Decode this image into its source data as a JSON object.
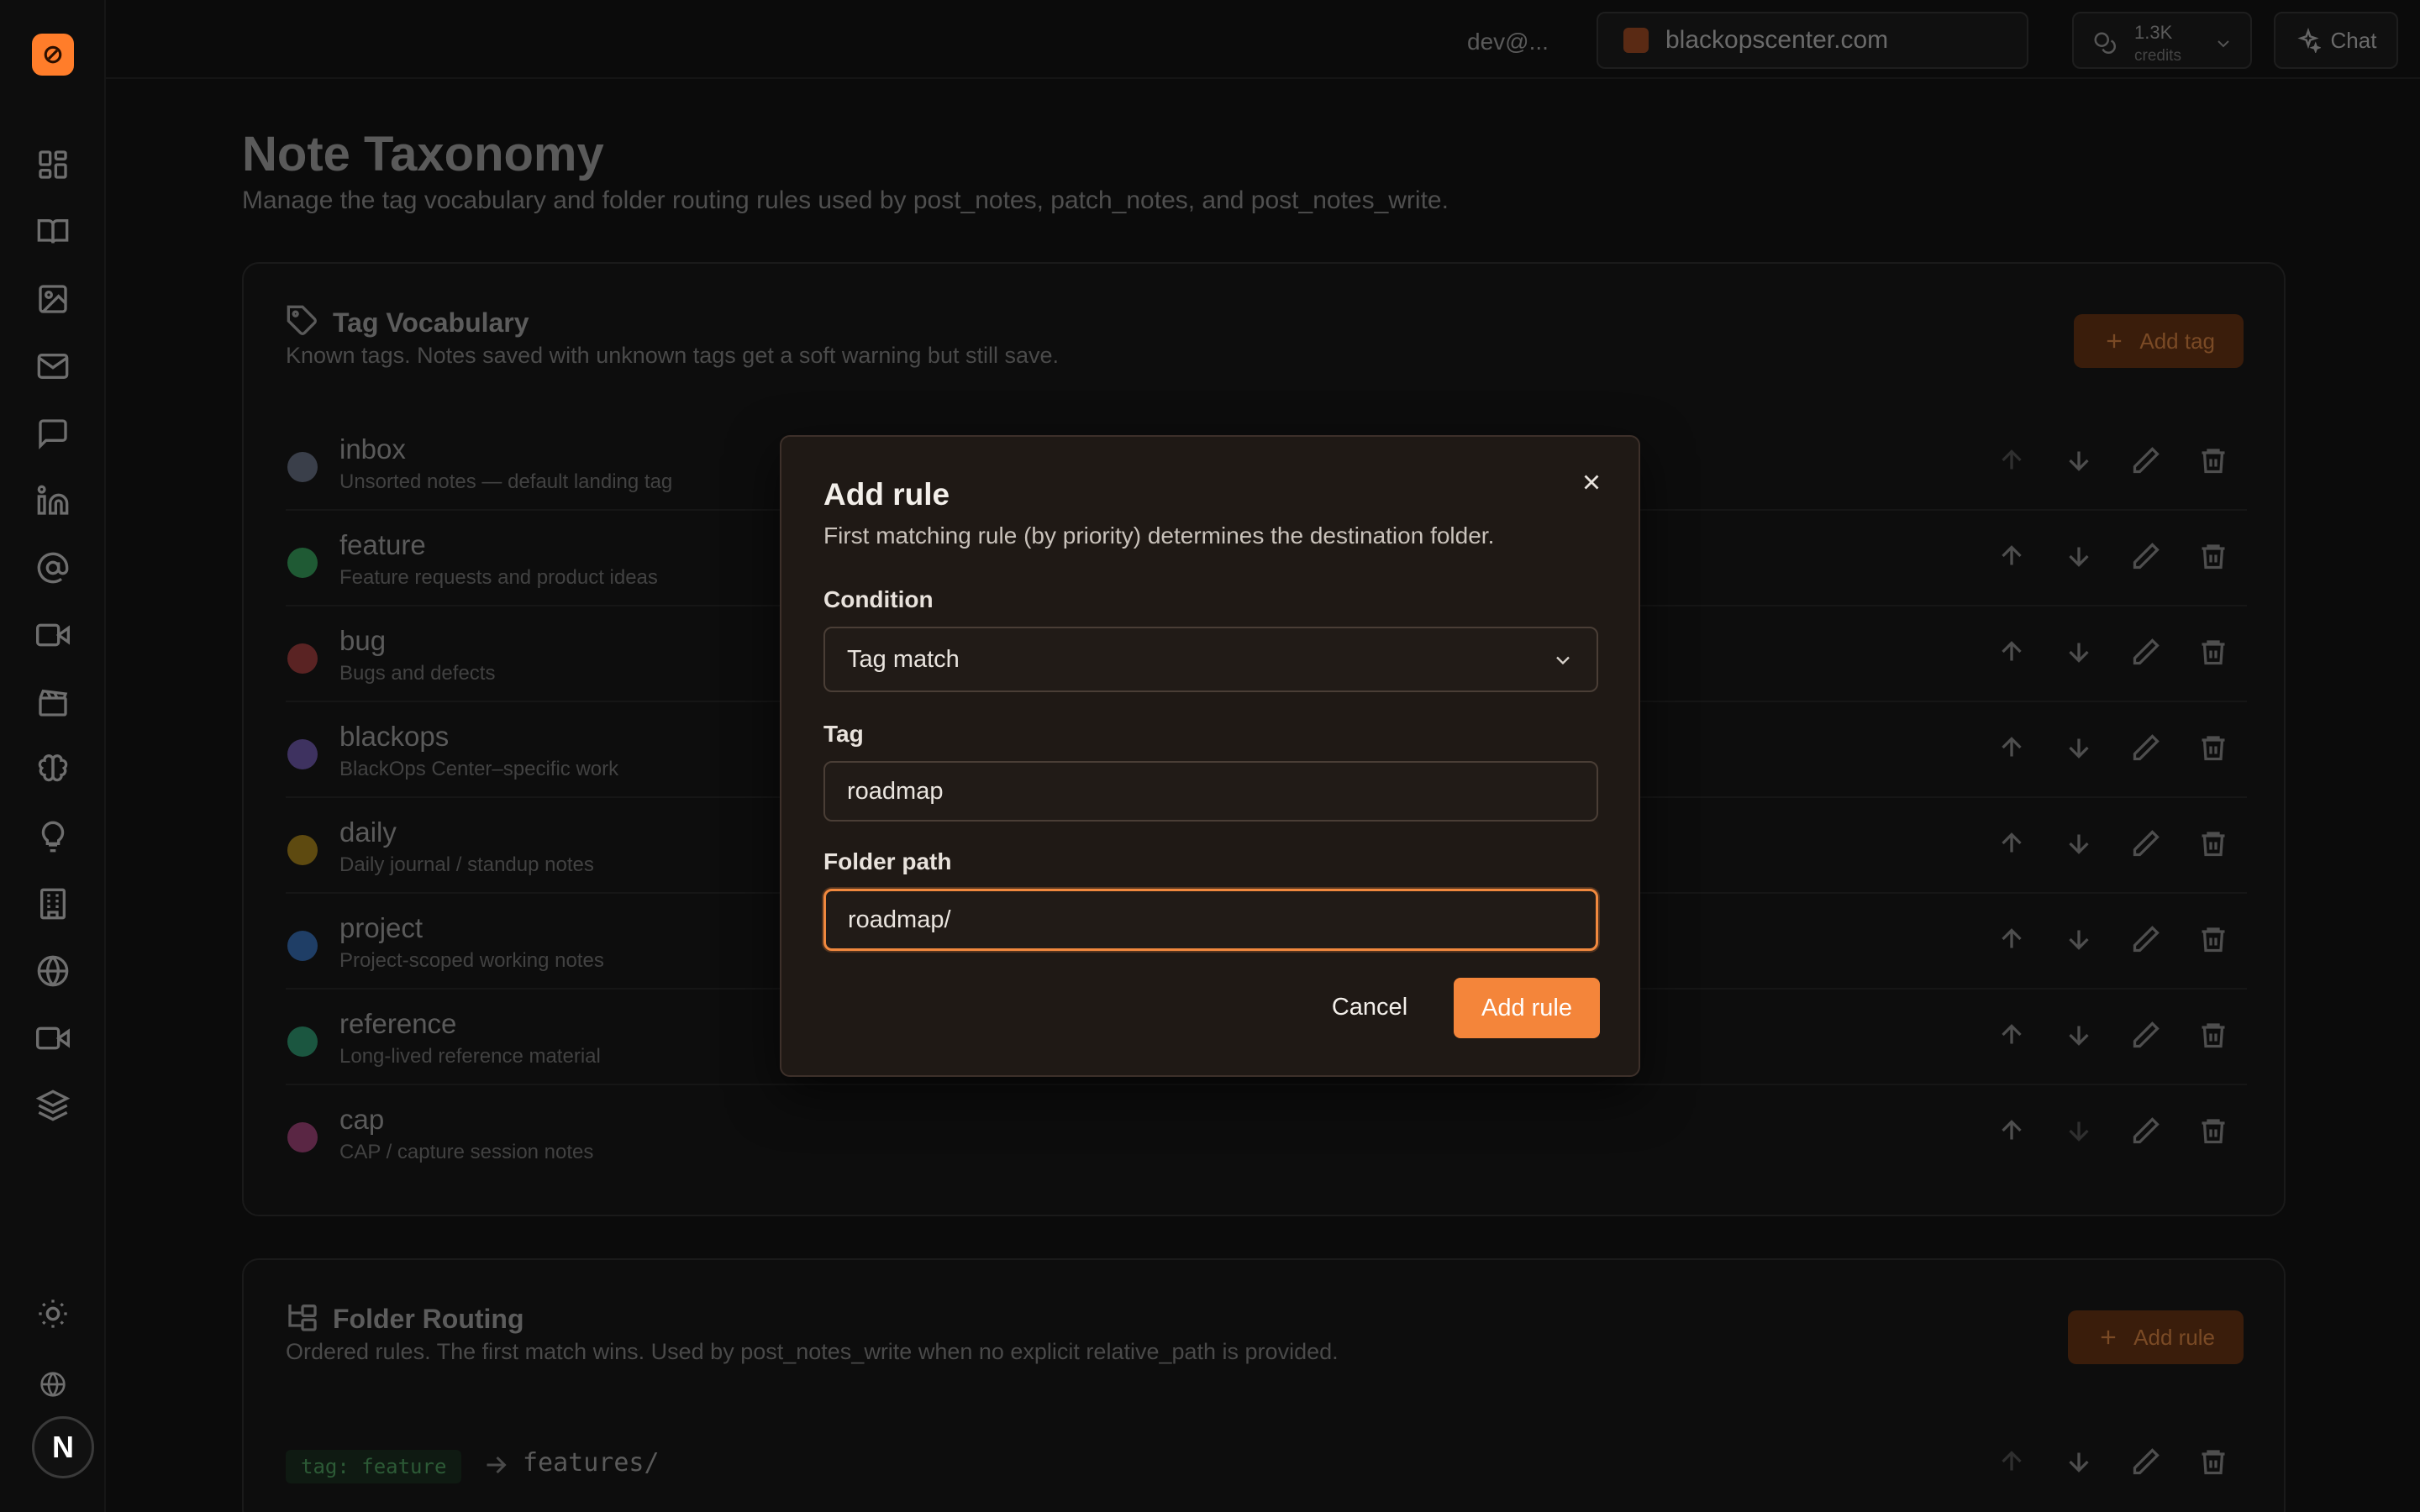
{
  "topbar": {
    "user": "dev@...",
    "site": "blackopscenter.com",
    "credits_value": "1.3K",
    "credits_label": "credits",
    "chat_label": "Chat"
  },
  "sidebar": {
    "avatar_initial": "N",
    "items": [
      "dashboard-icon",
      "book-icon",
      "image-icon",
      "mail-icon",
      "chat-bubble-icon",
      "linkedin-icon",
      "at-sign-icon",
      "video-icon",
      "clapperboard-icon",
      "brain-icon",
      "lightbulb-icon",
      "building-icon",
      "globe-icon",
      "camera-icon",
      "layers-icon"
    ]
  },
  "page": {
    "title": "Note Taxonomy",
    "subtitle": "Manage the tag vocabulary and folder routing rules used by post_notes, patch_notes, and post_notes_write."
  },
  "tag_vocabulary": {
    "title": "Tag Vocabulary",
    "description": "Known tags. Notes saved with unknown tags get a soft warning but still save.",
    "add_label": "Add tag",
    "tags": [
      {
        "name": "inbox",
        "desc": "Unsorted notes — default landing tag",
        "color": "#3a3f4a"
      },
      {
        "name": "feature",
        "desc": "Feature requests and product ideas",
        "color": "#1f5a34"
      },
      {
        "name": "bug",
        "desc": "Bugs and defects",
        "color": "#5a2323"
      },
      {
        "name": "blackops",
        "desc": "BlackOps Center–specific work",
        "color": "#3e3260"
      },
      {
        "name": "daily",
        "desc": "Daily journal / standup notes",
        "color": "#5e4a10"
      },
      {
        "name": "project",
        "desc": "Project-scoped working notes",
        "color": "#1f3e66"
      },
      {
        "name": "reference",
        "desc": "Long-lived reference material",
        "color": "#1b5640"
      },
      {
        "name": "cap",
        "desc": "CAP / capture session notes",
        "color": "#5a2644"
      }
    ]
  },
  "folder_routing": {
    "title": "Folder Routing",
    "description": "Ordered rules. The first match wins. Used by post_notes_write when no explicit relative_path is provided.",
    "add_label": "Add rule",
    "rules": [
      {
        "condition": "tag: feature",
        "path": "features/"
      }
    ]
  },
  "modal": {
    "title": "Add rule",
    "subtitle": "First matching rule (by priority) determines the destination folder.",
    "condition_label": "Condition",
    "condition_value": "Tag match",
    "tag_label": "Tag",
    "tag_value": "roadmap",
    "folder_label": "Folder path",
    "folder_value": "roadmap/",
    "cancel_label": "Cancel",
    "submit_label": "Add rule"
  }
}
